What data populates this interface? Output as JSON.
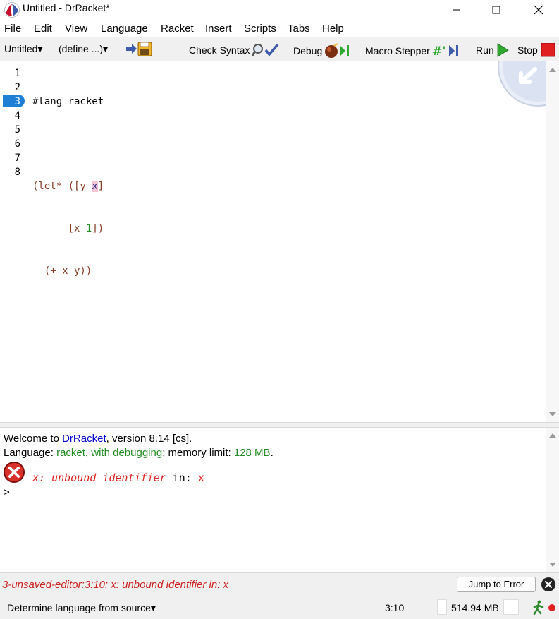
{
  "window": {
    "title": "Untitled - DrRacket*",
    "icons": {
      "logo": "racket-logo-icon",
      "minimize": "minimize-icon",
      "maximize": "maximize-icon",
      "close": "close-icon"
    }
  },
  "menu": [
    "File",
    "Edit",
    "View",
    "Language",
    "Racket",
    "Insert",
    "Scripts",
    "Tabs",
    "Help"
  ],
  "toolbar": {
    "file_selector": "Untitled▾",
    "define_selector": "(define ...)▾",
    "check_syntax": "Check Syntax",
    "debug": "Debug",
    "macro_stepper": "Macro Stepper",
    "run": "Run",
    "stop": "Stop"
  },
  "editor": {
    "line_numbers": [
      "1",
      "2",
      "3",
      "4",
      "5",
      "6",
      "7",
      "8"
    ],
    "active_line": "3",
    "code": {
      "l1": "#lang racket",
      "l3_open": "(let* ([y ",
      "l3_x": "x",
      "l3_close": "]",
      "l4_pad": "      ",
      "l4_open": "[x ",
      "l4_num": "1",
      "l4_close": "])",
      "l5_pad": "  ",
      "l5_open": "(+ x y))"
    }
  },
  "interactions": {
    "welcome_prefix": "Welcome to ",
    "welcome_link": "DrRacket",
    "welcome_suffix": ", version 8.14 [cs].",
    "language_prefix": "Language: ",
    "language_value": "racket, with debugging",
    "language_mid": "; memory limit: ",
    "memory_limit": "128 MB",
    "language_end": ".",
    "error_message": "x: unbound identifier",
    "error_in": " in: ",
    "error_ident": "x",
    "prompt": ">"
  },
  "errorbar": {
    "message": "3-unsaved-editor:3:10: x: unbound identifier in: x",
    "jump_button": "Jump to Error"
  },
  "status": {
    "language": "Determine language from source▾",
    "position": "3:10",
    "memory": "514.94 MB"
  },
  "colors": {
    "accent": "#1f7fd4",
    "error": "#cc2222",
    "keyword": "#843c24",
    "identifier": "#262680",
    "literal": "#228b22"
  }
}
